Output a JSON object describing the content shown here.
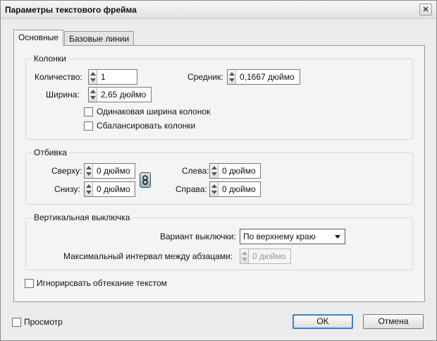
{
  "window": {
    "title": "Параметры текстового фрейма"
  },
  "tabs": [
    {
      "label": "Основные",
      "active": true
    },
    {
      "label": "Базовые линии",
      "active": false
    }
  ],
  "columns": {
    "title": "Колонки",
    "count_label": "Количество:",
    "count_value": "1",
    "gutter_label": "Средник:",
    "gutter_value": "0,1667 дюймо",
    "width_label": "Ширина:",
    "width_value": "2,65 дюймо",
    "fixed_width_label": "Одинаковая ширина колонок",
    "fixed_width_checked": false,
    "balance_label": "Сбалансировать колонки",
    "balance_checked": false
  },
  "inset": {
    "title": "Отбивка",
    "top_label": "Сверху:",
    "top_value": "0 дюймо",
    "bottom_label": "Снизу:",
    "bottom_value": "0 дюймо",
    "left_label": "Слева:",
    "left_value": "0 дюймо",
    "right_label": "Справа:",
    "right_value": "0 дюймо"
  },
  "vertical_justification": {
    "title": "Вертикальная выключка",
    "align_label": "Вариант выключки:",
    "align_value": "По верхнему краю",
    "para_spacing_label": "Максимальный интервал между абзацами:",
    "para_spacing_value": "0 дюймо"
  },
  "ignore_wrap": {
    "label": "Игнорирсвать обтекание текстом",
    "checked": false
  },
  "preview": {
    "label": "Просмотр",
    "checked": false
  },
  "buttons": {
    "ok": "OK",
    "cancel": "Отмена"
  },
  "colors": {
    "default_button_border": "#4a7dbb",
    "link_button": "#8fb3c6"
  }
}
